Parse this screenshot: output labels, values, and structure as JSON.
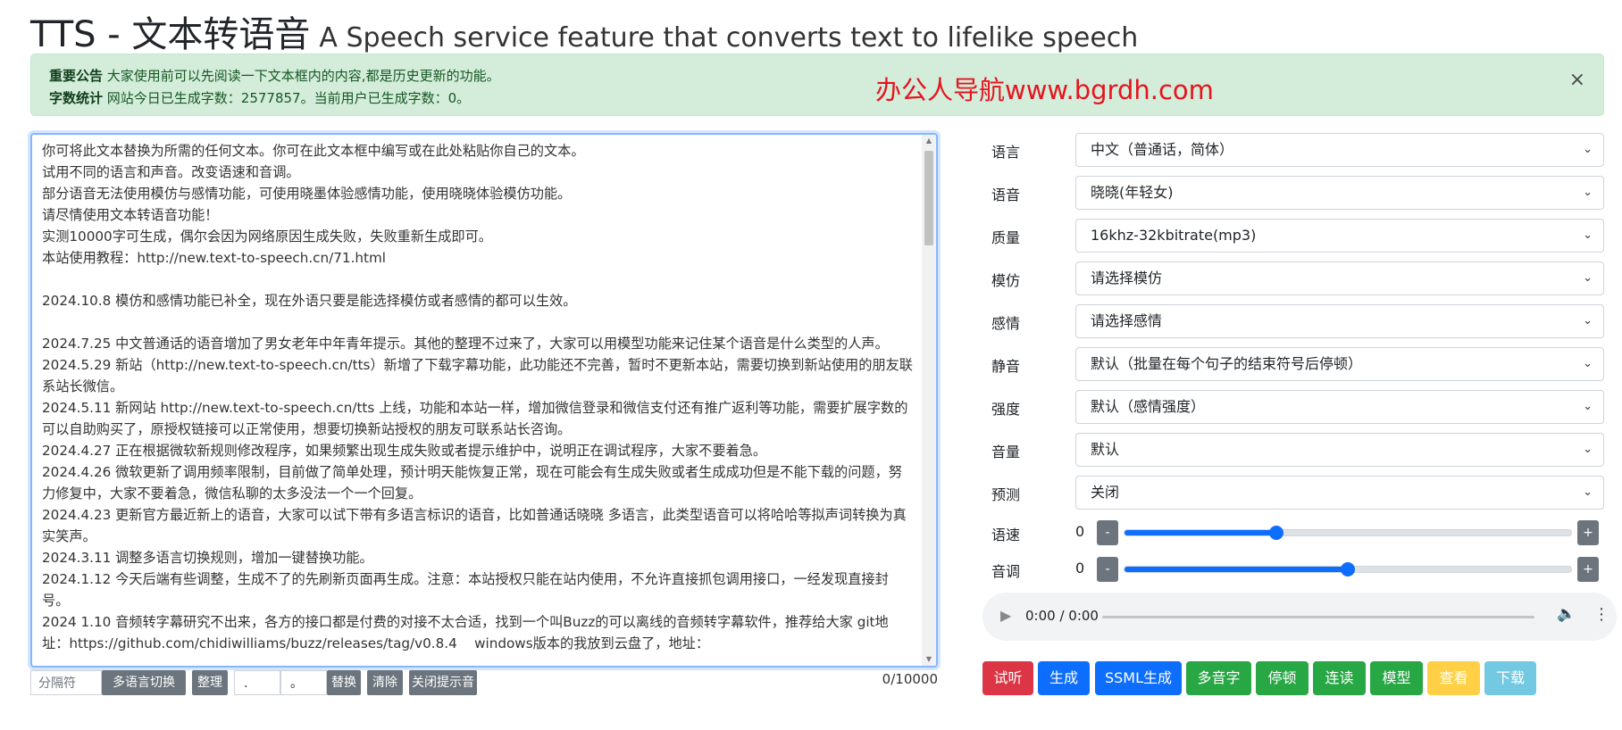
{
  "header": {
    "title": "TTS - 文本转语音",
    "subtitle": "A Speech service feature that converts text to lifelike speech"
  },
  "alert": {
    "notice_label": "重要公告",
    "notice_text": "大家使用前可以先阅读一下文本框内的内容,都是历史更新的功能。",
    "stats_label": "字数统计",
    "stats_text": "网站今日已生成字数：2577857。当前用户已生成字数：0。",
    "watermark": "办公人导航www.bgrdh.com",
    "close": "×"
  },
  "editor": {
    "content": "你可将此文本替换为所需的任何文本。你可在此文本框中编写或在此处粘贴你自己的文本。\n试用不同的语言和声音。改变语速和音调。\n部分语音无法使用模仿与感情功能，可使用晓墨体验感情功能，使用晓晓体验模仿功能。\n请尽情使用文本转语音功能！\n实测10000字可生成，偶尔会因为网络原因生成失败，失败重新生成即可。\n本站使用教程：http://new.text-to-speech.cn/71.html\n\n2024.10.8 模仿和感情功能已补全，现在外语只要是能选择模仿或者感情的都可以生效。\n\n2024.7.25 中文普通话的语音增加了男女老年中年青年提示。其他的整理不过来了，大家可以用模型功能来记住某个语音是什么类型的人声。\n2024.5.29 新站（http://new.text-to-speech.cn/tts）新增了下载字幕功能，此功能还不完善，暂时不更新本站，需要切换到新站使用的朋友联系站长微信。\n2024.5.11 新网站 http://new.text-to-speech.cn/tts 上线，功能和本站一样，增加微信登录和微信支付还有推广返利等功能，需要扩展字数的可以自助购买了，原授权链接可以正常使用，想要切换新站授权的朋友可联系站长咨询。\n2024.4.27 正在根据微软新规则修改程序，如果频繁出现生成失败或者提示维护中，说明正在调试程序，大家不要着急。\n2024.4.26 微软更新了调用频率限制，目前做了简单处理，预计明天能恢复正常，现在可能会有生成失败或者生成成功但是不能下载的问题，努力修复中，大家不要着急，微信私聊的太多没法一个一个回复。\n2024.4.23 更新官方最近新上的语音，大家可以试下带有多语言标识的语音，比如普通话晓晓 多语言，此类型语音可以将哈哈等拟声词转换为真实笑声。\n2024.3.11 调整多语言切换规则，增加一键替换功能。\n2024.1.12 今天后端有些调整，生成不了的先刷新页面再生成。注意：本站授权只能在站内使用，不允许直接抓包调用接口，一经发现直接封号。\n2024 1.10 音频转字幕研究不出来，各方的接口都是付费的对接不太合适，找到一个叫Buzz的可以离线的音频转字幕软件，推荐给大家 git地址：https://github.com/chidiwilliams/buzz/releases/tag/v0.8.4    windows版本的我放到云盘了，地址："
  },
  "toolbar": {
    "separator_placeholder": "分隔符",
    "multi_lang_btn": "多语言切换",
    "tidy_btn": "整理",
    "find_value": ".",
    "replace_value": "。",
    "replace_btn": "替换",
    "clear_btn": "清除",
    "close_tip_btn": "关闭提示音",
    "counter": "0/10000"
  },
  "settings": [
    {
      "label": "语言",
      "value": "中文（普通话，简体）"
    },
    {
      "label": "语音",
      "value": "晓晓(年轻女)"
    },
    {
      "label": "质量",
      "value": "16khz-32kbitrate(mp3)"
    },
    {
      "label": "模仿",
      "value": "请选择模仿"
    },
    {
      "label": "感情",
      "value": "请选择感情"
    },
    {
      "label": "静音",
      "value": "默认（批量在每个句子的结束符号后停顿）"
    },
    {
      "label": "强度",
      "value": "默认（感情强度）"
    },
    {
      "label": "音量",
      "value": "默认"
    },
    {
      "label": "预测",
      "value": "关闭"
    }
  ],
  "sliders": {
    "rate": {
      "label": "语速",
      "value": "0",
      "level": 0.34
    },
    "pitch": {
      "label": "音调",
      "value": "0",
      "level": 0.5
    }
  },
  "slider_buttons": {
    "minus": "-",
    "plus": "+"
  },
  "audio": {
    "time": "0:00 / 0:00"
  },
  "actions": [
    {
      "label": "试听",
      "color": "#dc3545"
    },
    {
      "label": "生成",
      "color": "#0d6efd"
    },
    {
      "label": "SSML生成",
      "color": "#0d6efd"
    },
    {
      "label": "多音字",
      "color": "#28a745"
    },
    {
      "label": "停顿",
      "color": "#28a745"
    },
    {
      "label": "连读",
      "color": "#28a745"
    },
    {
      "label": "模型",
      "color": "#28a745"
    },
    {
      "label": "查看",
      "color": "#ffc107"
    },
    {
      "label": "下载",
      "color": "#5bc0de"
    }
  ]
}
